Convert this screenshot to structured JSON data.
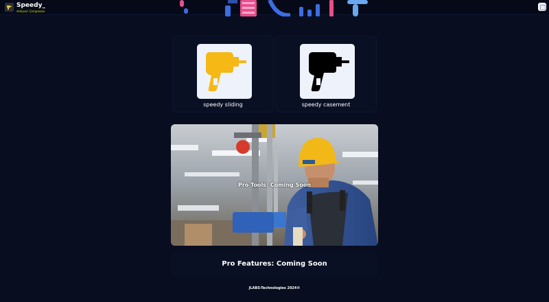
{
  "header": {
    "brand_name": "Speedy_",
    "tagline": "Artisans' Companion",
    "logo_icon": "logo-icon",
    "menu_icon": "menu-icon"
  },
  "tools": [
    {
      "label": "speedy sliding",
      "icon": "drill-icon",
      "icon_color": "#f5b815"
    },
    {
      "label": "speedy casement",
      "icon": "drill-icon",
      "icon_color": "#000000"
    }
  ],
  "banner": {
    "text": "Pro Tools: Coming Soon",
    "image": "worker-drill-press-photo"
  },
  "pro_features": {
    "text": "Pro Features: Coming Soon"
  },
  "footer": {
    "text": "JLABS-Technologies 2024©"
  },
  "colors": {
    "background": "#080d1f",
    "card": "#0a1024",
    "thumb": "#eef3fb"
  }
}
